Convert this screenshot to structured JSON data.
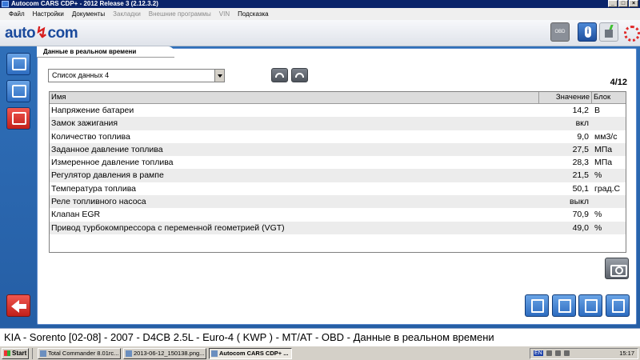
{
  "window": {
    "title": "Autocom CARS CDP+ - 2012 Release 3 (2.12.3.2)",
    "buttons": {
      "minimize": "_",
      "maximize": "□",
      "close": "×"
    }
  },
  "menu": {
    "items": [
      {
        "label": "Файл",
        "enabled": true
      },
      {
        "label": "Настройки",
        "enabled": true
      },
      {
        "label": "Документы",
        "enabled": true
      },
      {
        "label": "Закладки",
        "enabled": false
      },
      {
        "label": "Внешние программы",
        "enabled": false
      },
      {
        "label": "VIN",
        "enabled": false
      },
      {
        "label": "Подсказка",
        "enabled": true
      }
    ]
  },
  "header": {
    "logo_left": "auto",
    "logo_mark": "↯",
    "logo_right": "com",
    "obd_label": "OBD"
  },
  "panel": {
    "tab_title": "Данные в реальном времени",
    "select_value": "Список данных 4",
    "page_count": "4/12"
  },
  "table": {
    "headers": {
      "name": "Имя",
      "value": "Значение",
      "unit": "Блок"
    },
    "rows": [
      {
        "name": "Напряжение батареи",
        "value": "14,2",
        "unit": "В"
      },
      {
        "name": "Замок зажигания",
        "value": "вкл",
        "unit": ""
      },
      {
        "name": "Количество топлива",
        "value": "9,0",
        "unit": "мм3/с"
      },
      {
        "name": "Заданное давление топлива",
        "value": "27,5",
        "unit": "МПа"
      },
      {
        "name": "Измеренное давление топлива",
        "value": "28,3",
        "unit": "МПа"
      },
      {
        "name": "Регулятор давления в рампе",
        "value": "21,5",
        "unit": "%"
      },
      {
        "name": "Температура топлива",
        "value": "50,1",
        "unit": "град.С"
      },
      {
        "name": "Реле топливного насоса",
        "value": "выкл",
        "unit": ""
      },
      {
        "name": "Клапан EGR",
        "value": "70,9",
        "unit": "%"
      },
      {
        "name": "Привод турбокомпрессора с переменной геометрией (VGT)",
        "value": "49,0",
        "unit": "%"
      }
    ]
  },
  "status": {
    "text": "KIA - Sorento [02-08] - 2007 - D4CB 2.5L - Euro-4 ( KWP ) - MT/AT - OBD - Данные в реальном времени"
  },
  "taskbar": {
    "start_label": "Start",
    "tasks": [
      {
        "label": "Total Commander 8.01rc...",
        "active": false
      },
      {
        "label": "2013-06-12_150138.png...",
        "active": false
      },
      {
        "label": "Autocom CARS CDP+ ...",
        "active": true
      }
    ],
    "lang": "EN",
    "clock": "15:17"
  },
  "colors": {
    "accent_blue": "#2f6fb8",
    "active_red": "#c1201a",
    "title_bar": "#0a246a"
  }
}
